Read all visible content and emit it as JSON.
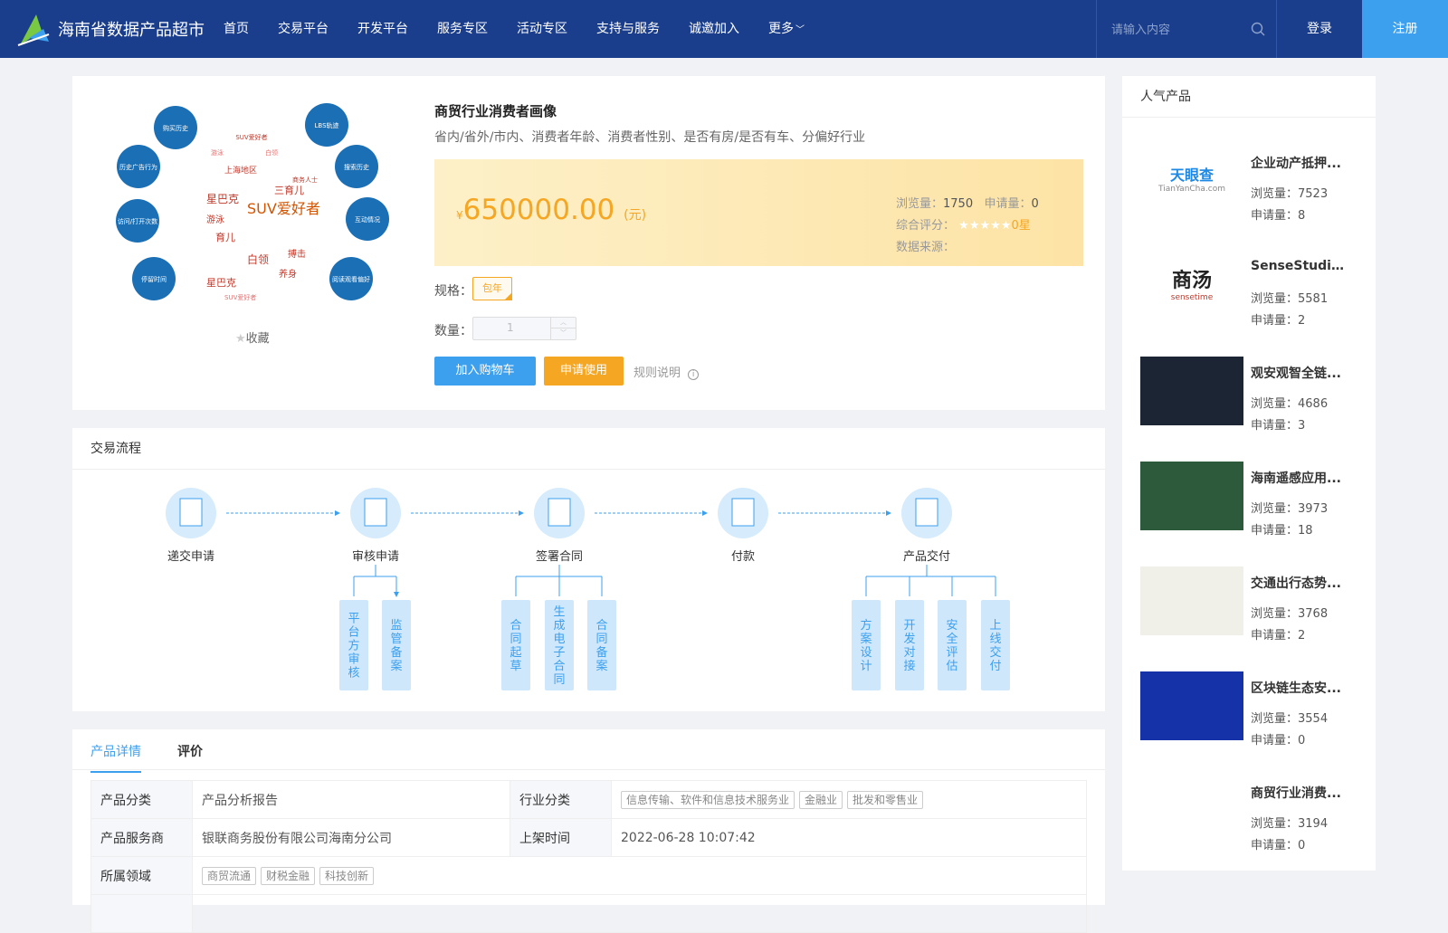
{
  "header": {
    "title": "海南省数据产品超市",
    "nav": [
      "首页",
      "交易平台",
      "开发平台",
      "服务专区",
      "活动专区",
      "支持与服务",
      "诚邀加入",
      "更多"
    ],
    "search_placeholder": "请输入内容",
    "login": "登录",
    "register": "注册"
  },
  "product": {
    "image_keywords": [
      "购买历史",
      "LBS轨迹",
      "历史广告行为",
      "搜索历史",
      "访问/打开次数",
      "互动情况",
      "停留时间",
      "阅读观看偏好",
      "SUV爱好者",
      "星巴克",
      "游泳",
      "上海地区",
      "育儿",
      "白领",
      "搏击",
      "养身",
      "三育儿",
      "商务人士"
    ],
    "favorite": "收藏",
    "title": "商贸行业消费者画像",
    "subtitle": "省内/省外/市内、消费者年龄、消费者性别、是否有房/是否有车、分偏好行业",
    "currency": "¥",
    "price": "650000.00",
    "unit": "(元)",
    "views_label": "浏览量：",
    "views": "1750",
    "applies_label": "申请量：",
    "applies": "0",
    "rating_label": "综合评分：",
    "rating_value": "0星",
    "rating_stars": 0,
    "source_label": "数据来源：",
    "source": "",
    "spec_label": "规格：",
    "spec_value": "包年",
    "qty_label": "数量：",
    "qty_value": "1",
    "add_cart": "加入购物车",
    "apply": "申请使用",
    "rules": "规则说明"
  },
  "flow": {
    "title": "交易流程",
    "steps": [
      "递交申请",
      "审核申请",
      "签署合同",
      "付款",
      "产品交付"
    ],
    "sub_review": [
      "平台方审核",
      "监管备案"
    ],
    "sub_contract": [
      "合同起草",
      "生成电子合同",
      "合同备案"
    ],
    "sub_delivery": [
      "方案设计",
      "开发对接",
      "安全评估",
      "上线交付"
    ]
  },
  "details": {
    "tabs": [
      "产品详情",
      "评价"
    ],
    "rows": {
      "category_label": "产品分类",
      "category": "产品分析报告",
      "industry_label": "行业分类",
      "industry_tags": [
        "信息传输、软件和信息技术服务业",
        "金融业",
        "批发和零售业"
      ],
      "provider_label": "产品服务商",
      "provider": "银联商务股份有限公司海南分公司",
      "online_label": "上架时间",
      "online": "2022-06-28 10:07:42",
      "domain_label": "所属领域",
      "domain_tags": [
        "商贸流通",
        "财税金融",
        "科技创新"
      ]
    }
  },
  "popular": {
    "title": "人气产品",
    "view_label": "浏览量：",
    "apply_label": "申请量：",
    "items": [
      {
        "name": "企业动产抵押...",
        "views": "7523",
        "applies": "8",
        "thumb_text": "天眼查",
        "thumb_sub": "TianYanCha.com"
      },
      {
        "name": "SenseStudio...",
        "views": "5581",
        "applies": "2",
        "thumb_text": "商汤",
        "thumb_sub": "sensetime"
      },
      {
        "name": "观安观智全链...",
        "views": "4686",
        "applies": "3"
      },
      {
        "name": "海南遥感应用...",
        "views": "3973",
        "applies": "18"
      },
      {
        "name": "交通出行态势...",
        "views": "3768",
        "applies": "2"
      },
      {
        "name": "区块链生态安...",
        "views": "3554",
        "applies": "0"
      },
      {
        "name": "商贸行业消费...",
        "views": "3194",
        "applies": "0"
      }
    ]
  },
  "colors": {
    "header": "#1a3e8c",
    "accent": "#3ca0ef",
    "price": "#f5a623"
  }
}
